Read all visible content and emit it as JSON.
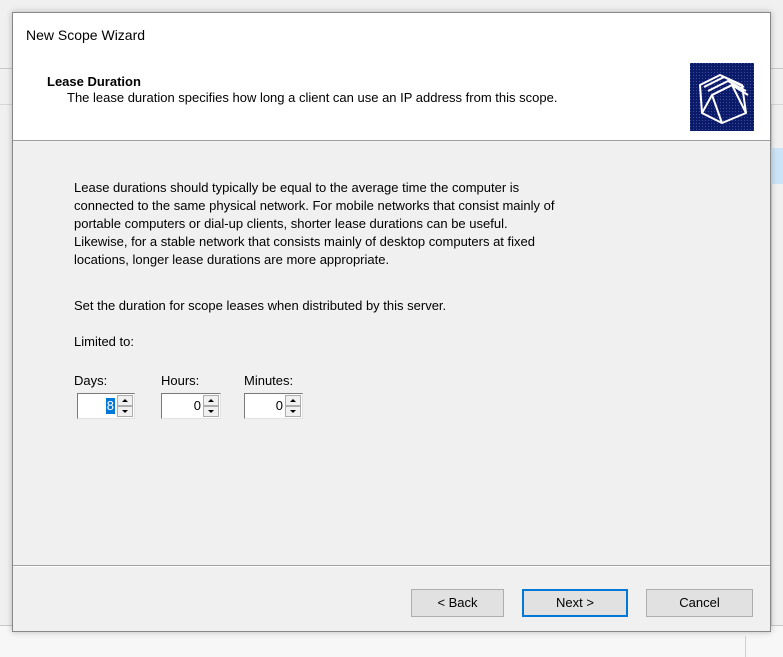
{
  "window": {
    "title": "New Scope Wizard"
  },
  "header": {
    "heading": "Lease Duration",
    "subheading": "The lease duration specifies how long a client can use an IP address from this scope.",
    "icon": "folders-icon"
  },
  "body": {
    "description_lines": [
      "Lease durations should typically be equal to the average time the computer is",
      "connected to the same physical network. For mobile networks that consist mainly of",
      "portable computers or dial-up clients, shorter lease durations can be useful.",
      "Likewise, for a stable network that consists mainly of desktop computers at fixed",
      "locations, longer lease durations are more appropriate."
    ],
    "set_text": "Set the duration for scope leases when distributed by this server.",
    "limited_to": "Limited to:",
    "fields": {
      "days": {
        "label": "Days:",
        "value": "8"
      },
      "hours": {
        "label": "Hours:",
        "value": "0"
      },
      "minutes": {
        "label": "Minutes:",
        "value": "0"
      }
    }
  },
  "buttons": {
    "back": "< Back",
    "next": "Next >",
    "cancel": "Cancel"
  },
  "colors": {
    "accent": "#0078d7",
    "header_icon_bg": "#0c1a6a",
    "dialog_bg": "#f0f0f0"
  }
}
